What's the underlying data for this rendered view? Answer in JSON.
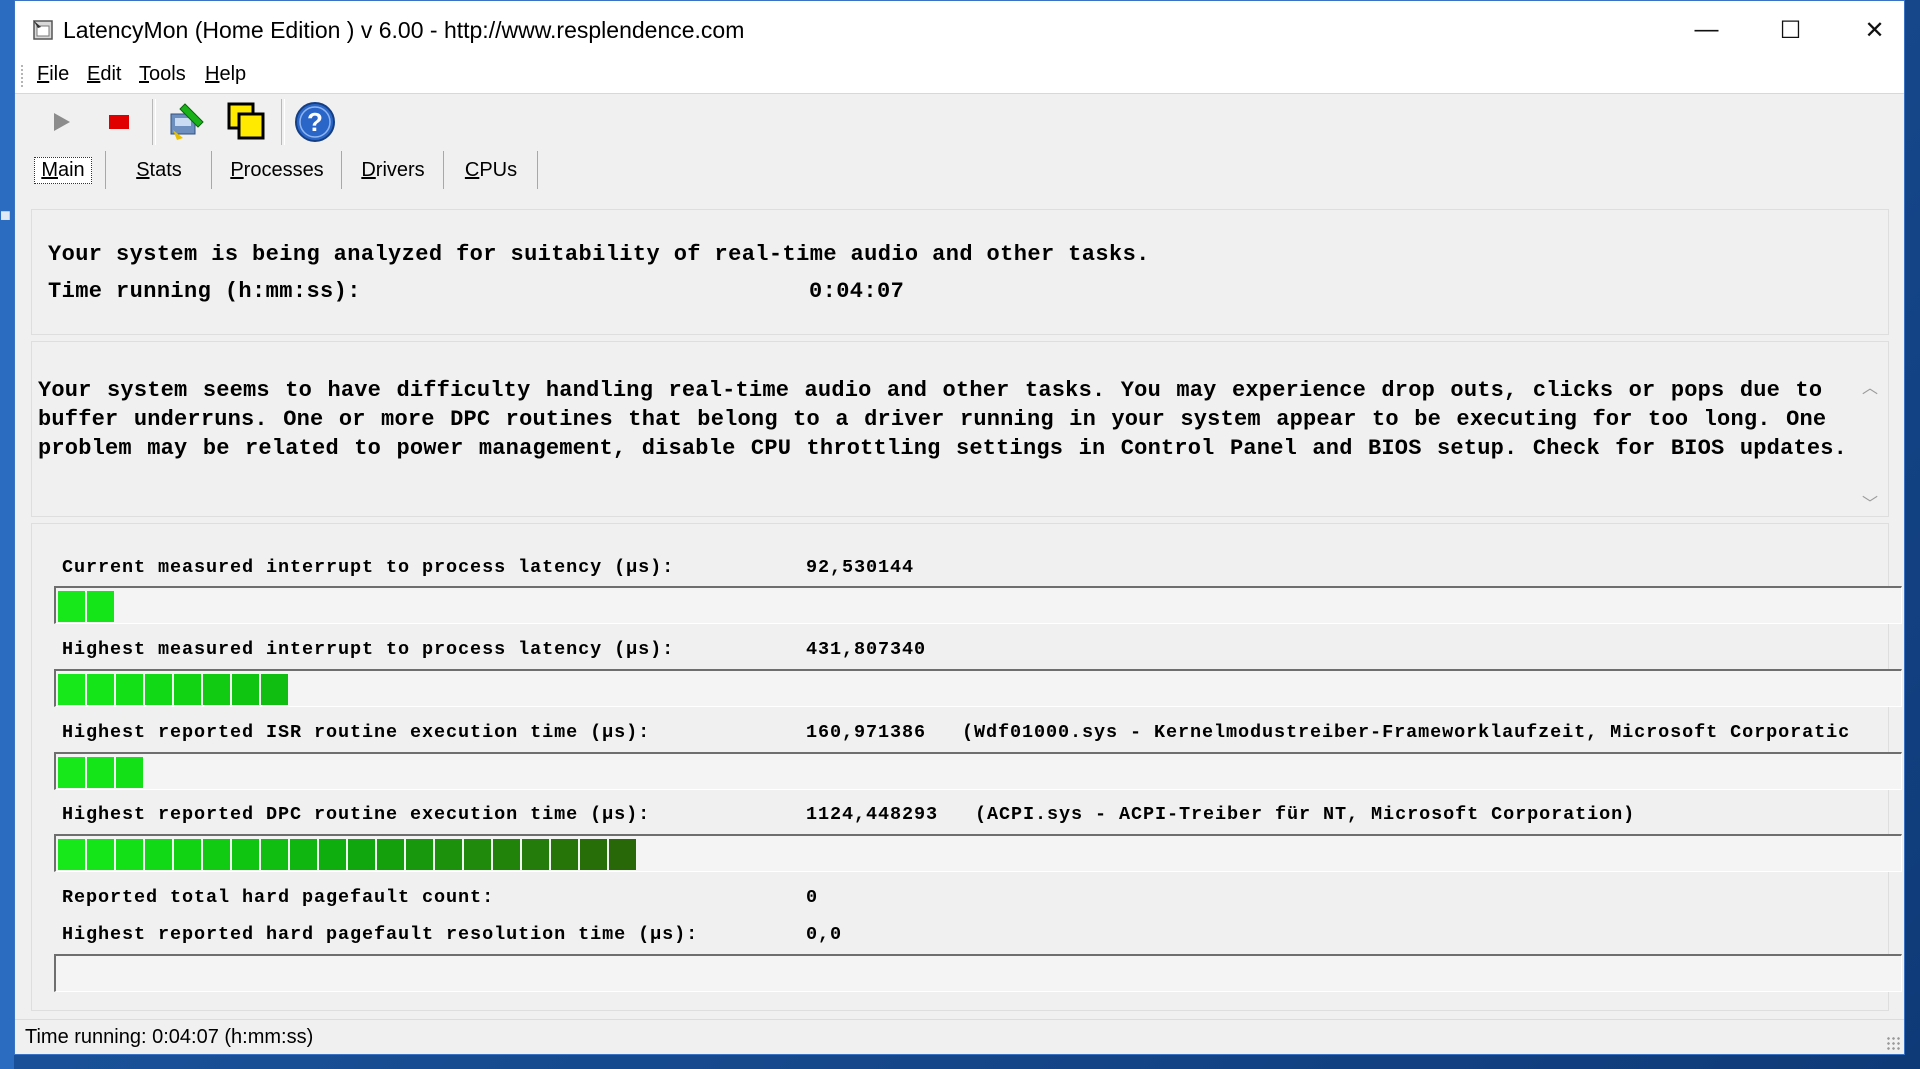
{
  "window": {
    "title": "LatencyMon  (Home Edition )  v 6.00 - http://www.resplendence.com",
    "controls": {
      "minimize": "—",
      "maximize": "☐",
      "close": "✕"
    }
  },
  "menu": [
    {
      "mnemonic": "F",
      "rest": "ile"
    },
    {
      "mnemonic": "E",
      "rest": "dit"
    },
    {
      "mnemonic": "T",
      "rest": "ools"
    },
    {
      "mnemonic": "H",
      "rest": "elp"
    }
  ],
  "toolbar": {
    "icons": [
      "play-icon",
      "stop-icon",
      "driver-icon",
      "copy-windows-icon",
      "help-icon"
    ],
    "colors": {
      "stop": "#e00000",
      "help": "#2a66c8"
    }
  },
  "tabs": [
    {
      "mnemonic": "M",
      "rest": "ain",
      "active": true
    },
    {
      "mnemonic": "S",
      "rest": "tats",
      "active": false
    },
    {
      "mnemonic": "P",
      "rest": "rocesses",
      "active": false
    },
    {
      "mnemonic": "D",
      "rest": "rivers",
      "active": false
    },
    {
      "mnemonic": "C",
      "rest": "PUs",
      "active": false
    }
  ],
  "status_panel": {
    "line1": "Your system is being analyzed for suitability of real-time audio and other tasks.",
    "time_label": "Time running (h:mm:ss):",
    "time_value": "0:04:07"
  },
  "message": "Your system seems to have difficulty handling real-time audio and other tasks. You may experience drop outs, clicks or pops due to buffer underruns. One or more DPC routines that belong to a driver running in your system appear to be executing for too long. One problem may be related to power management, disable CPU throttling settings in Control Panel and BIOS setup. Check for BIOS updates.",
  "metrics": [
    {
      "label": "Current measured interrupt to process latency (µs):",
      "value": "92,530144",
      "detail": "",
      "bar_segments": 2
    },
    {
      "label": "Highest measured interrupt to process latency (µs):",
      "value": "431,807340",
      "detail": "",
      "bar_segments": 8
    },
    {
      "label": "Highest reported ISR routine execution time (µs):",
      "value": "160,971386",
      "detail": "(Wdf01000.sys - Kernelmodustreiber-Frameworklaufzeit, Microsoft Corporatic",
      "bar_segments": 3
    },
    {
      "label": "Highest reported DPC routine execution time (µs):",
      "value": "1124,448293",
      "detail": "(ACPI.sys - ACPI-Treiber für NT, Microsoft Corporation)",
      "bar_segments": 20
    },
    {
      "label": "Reported total hard pagefault count:",
      "value": "0",
      "detail": ""
    },
    {
      "label": "Highest reported hard pagefault resolution time (µs):",
      "value": "0,0",
      "detail": "",
      "bar_segments": 0
    }
  ],
  "bar_colors": [
    "#16e81a",
    "#14e518",
    "#13e016",
    "#12d915",
    "#12d214",
    "#11cb13",
    "#10c412",
    "#10bd11",
    "#0fb610",
    "#0fae0f",
    "#10a70e",
    "#14a00d",
    "#18980c",
    "#1c910b",
    "#1f8a0b",
    "#22830a",
    "#247c0a",
    "#267509",
    "#276e09",
    "#286809"
  ],
  "statusbar": {
    "text": "Time running: 0:04:07  (h:mm:ss)"
  }
}
